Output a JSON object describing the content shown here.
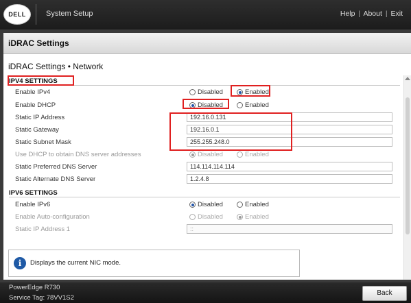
{
  "topbar": {
    "logo_text": "DELL",
    "app_title": "System Setup",
    "links": {
      "help": "Help",
      "about": "About",
      "exit": "Exit",
      "separator": "|"
    }
  },
  "panel": {
    "header": "iDRAC Settings",
    "page_title": "iDRAC Settings • Network"
  },
  "ipv4": {
    "section_title": "IPV4 SETTINGS",
    "enable_ipv4": {
      "label": "Enable IPv4",
      "options": [
        "Disabled",
        "Enabled"
      ],
      "selected": "Enabled"
    },
    "enable_dhcp": {
      "label": "Enable DHCP",
      "options": [
        "Disabled",
        "Enabled"
      ],
      "selected": "Disabled"
    },
    "static_ip": {
      "label": "Static IP Address",
      "value": "192.16.0.131"
    },
    "static_gateway": {
      "label": "Static Gateway",
      "value": "192.16.0.1"
    },
    "static_subnet": {
      "label": "Static Subnet Mask",
      "value": "255.255.248.0"
    },
    "dhcp_dns": {
      "label": "Use DHCP to obtain DNS server addresses",
      "options": [
        "Disabled",
        "Enabled"
      ],
      "selected": "Disabled"
    },
    "pref_dns": {
      "label": "Static Preferred DNS Server",
      "value": "114.114.114.114"
    },
    "alt_dns": {
      "label": "Static Alternate DNS Server",
      "value": "1.2.4.8"
    }
  },
  "ipv6": {
    "section_title": "IPV6 SETTINGS",
    "enable_ipv6": {
      "label": "Enable IPv6",
      "options": [
        "Disabled",
        "Enabled"
      ],
      "selected": "Disabled"
    },
    "autoconf": {
      "label": "Enable Auto-configuration",
      "options": [
        "Disabled",
        "Enabled"
      ],
      "selected": "Enabled"
    },
    "static_ip1": {
      "label": "Static IP Address 1",
      "value": "::"
    }
  },
  "info": {
    "icon": "info-icon",
    "text": "Displays the current NIC mode."
  },
  "footer": {
    "model": "PowerEdge R730",
    "service_tag": "Service Tag: 78VV1S2",
    "back_label": "Back"
  },
  "colors": {
    "highlight": "#e02020",
    "radio_selected": "#2255aa",
    "topbar": "#1c1c1c"
  }
}
